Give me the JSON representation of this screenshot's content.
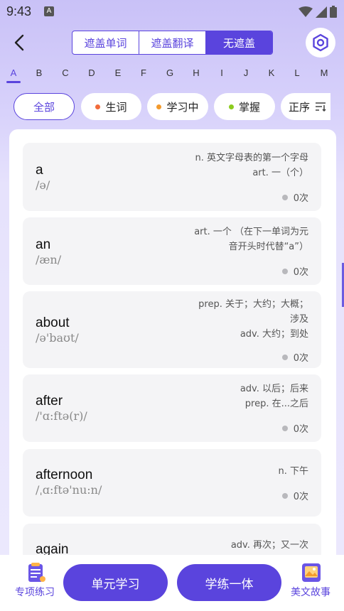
{
  "status": {
    "time": "9:43",
    "notif": "A"
  },
  "tabs": [
    "遮盖单词",
    "遮盖翻译",
    "无遮盖"
  ],
  "active_tab": 2,
  "alphabet": [
    "A",
    "B",
    "C",
    "D",
    "E",
    "F",
    "G",
    "H",
    "I",
    "J",
    "K",
    "L",
    "M"
  ],
  "filters": {
    "all": "全部",
    "new": "生词",
    "learning": "学习中",
    "mastered": "掌握",
    "order": "正序"
  },
  "colors": {
    "accent": "#5a44dd",
    "new_dot": "#f26b3a",
    "learning_dot": "#f39a2c",
    "mastered_dot": "#8ccc1e"
  },
  "words": [
    {
      "word": "a",
      "phonetic": "/ə/",
      "trans": [
        "n. 英文字母表的第一个字母",
        "art. 一（个）"
      ],
      "count": "0次"
    },
    {
      "word": "an",
      "phonetic": "/æn/",
      "trans": [
        "art. 一个 （在下一单词为元",
        "音开头时代替“a”）"
      ],
      "count": "0次"
    },
    {
      "word": "about",
      "phonetic": "/ə'baʊt/",
      "trans": [
        "prep. 关于；大约；大概；",
        "涉及",
        "adv. 大约；到处"
      ],
      "count": "0次"
    },
    {
      "word": "after",
      "phonetic": "/'ɑ:ftə(r)/",
      "trans": [
        "adv. 以后；后来",
        "prep. 在...之后"
      ],
      "count": "0次"
    },
    {
      "word": "afternoon",
      "phonetic": "/ˌɑ:ftə'nu:n/",
      "trans": [
        "n. 下午"
      ],
      "count": "0次"
    },
    {
      "word": "again",
      "phonetic": "",
      "trans": [
        "adv. 再次；又一次"
      ],
      "count": ""
    }
  ],
  "bottom": {
    "special": "专项练习",
    "unit": "单元学习",
    "practice": "学练一体",
    "story": "美文故事"
  }
}
